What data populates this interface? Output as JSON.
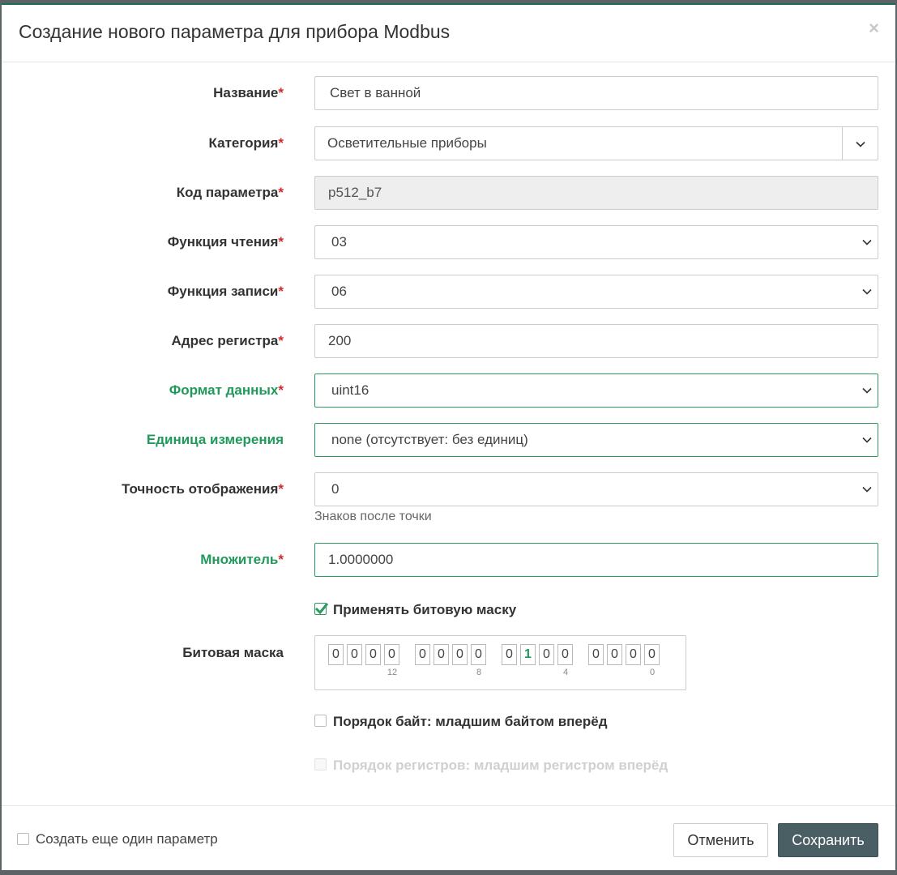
{
  "modal": {
    "title": "Создание нового параметра для прибора Modbus",
    "close_symbol": "×"
  },
  "required_mark": "*",
  "form": {
    "name": {
      "label": "Название",
      "value": "Свет в ванной"
    },
    "category": {
      "label": "Категория",
      "value": "Осветительные приборы"
    },
    "code": {
      "label": "Код параметра",
      "value": "p512_b7"
    },
    "read_func": {
      "label": "Функция чтения",
      "value": "03"
    },
    "write_func": {
      "label": "Функция записи",
      "value": "06"
    },
    "register": {
      "label": "Адрес регистра",
      "value": "200"
    },
    "data_format": {
      "label": "Формат данных",
      "value": "uint16"
    },
    "unit": {
      "label": "Единица измерения",
      "value": "none (отсутствует: без единиц)"
    },
    "precision": {
      "label": "Точность отображения",
      "value": "0",
      "help": "Знаков после точки"
    },
    "multiplier": {
      "label": "Множитель",
      "value": "1.0000000"
    },
    "apply_mask": {
      "label": "Применять битовую маску",
      "checked": true
    },
    "bitmask": {
      "label": "Битовая маска",
      "bits": [
        "0",
        "0",
        "0",
        "0",
        "0",
        "0",
        "0",
        "0",
        "0",
        "1",
        "0",
        "0",
        "0",
        "0",
        "0",
        "0"
      ],
      "indices": [
        "12",
        "8",
        "4",
        "0"
      ]
    },
    "byte_order": {
      "label": "Порядок байт: младшим байтом вперёд",
      "checked": false
    },
    "register_order": {
      "label": "Порядок регистров: младшим регистром вперёд",
      "checked": false,
      "disabled": true
    }
  },
  "footer": {
    "create_another": "Создать еще один параметр",
    "cancel": "Отменить",
    "save": "Сохранить"
  },
  "colors": {
    "accent_green": "#1f9a5a",
    "required_red": "#d62a2a",
    "save_button": "#4a5f64"
  }
}
